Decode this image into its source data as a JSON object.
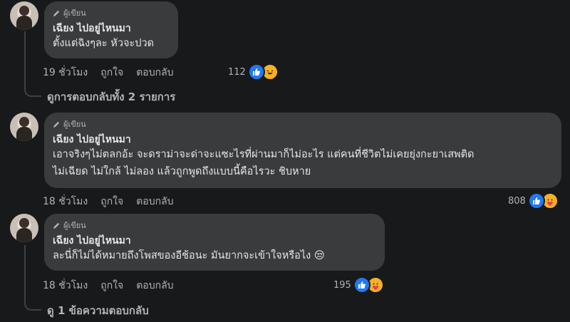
{
  "comments": [
    {
      "badge": "ผู้เขียน",
      "author": "เฉียง ไปอยู่ไหนมา",
      "lines": [
        "ตั้งแต่ฉิงๆละ หัวจะปวด"
      ],
      "time": "19 ชั่วโมง",
      "like_label": "ถูกใจ",
      "reply_label": "ตอบกลับ",
      "reaction_count": "112",
      "reaction_icons": [
        "like-icon",
        "haha-icon"
      ]
    },
    {
      "badge": "ผู้เขียน",
      "author": "เฉียง ไปอยู่ไหนมา",
      "lines": [
        "เอาจริงๆไม่ตลกอ้ะ จะดราม่าจะด่าจะแซะไรที่ผ่านมาก็ไม่อะไร แต่คนที่ชีวิตไม่เคยยุ่งกะยาเสพติด",
        "ไม่เฉียด ไม่ใกล้ ไม่ลอง แล้วถูกพูดถึงแบบนี้คือไรวะ ชิบหาย"
      ],
      "time": "18 ชั่วโมง",
      "like_label": "ถูกใจ",
      "reply_label": "ตอบกลับ",
      "reaction_count": "808",
      "reaction_icons": [
        "like-icon",
        "care-icon"
      ]
    },
    {
      "badge": "ผู้เขียน",
      "author": "เฉียง ไปอยู่ไหนมา",
      "lines": [
        "ละนี่ก็ไม่ได้หมายถึงโพสของอีช้อนะ มันยากจะเข้าใจหรือไง 😒"
      ],
      "time": "18 ชั่วโมง",
      "like_label": "ถูกใจ",
      "reply_label": "ตอบกลับ",
      "reaction_count": "195",
      "reaction_icons": [
        "like-icon",
        "care-icon"
      ]
    }
  ],
  "view_replies_1": "ดูการตอบกลับทั้ง 2 รายการ",
  "view_replies_3": "ดู 1 ข้อความตอบกลับ",
  "colors": {
    "background": "#18191a",
    "bubble": "#3a3b3c",
    "text": "#e4e6eb",
    "muted": "#b0b3b8",
    "like_blue": "#2078f4",
    "emoji_yellow": "#f7b125"
  }
}
